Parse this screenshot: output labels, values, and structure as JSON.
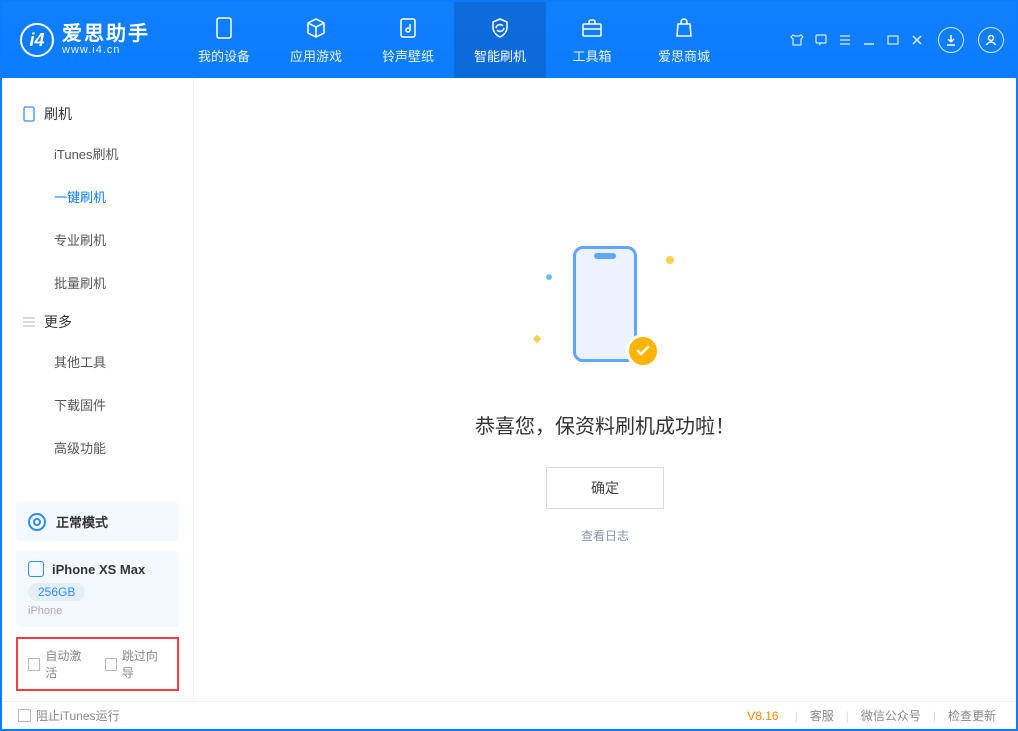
{
  "app": {
    "name_cn": "爱思助手",
    "url": "www.i4.cn"
  },
  "tabs": {
    "device": "我的设备",
    "apps": "应用游戏",
    "ringtone": "铃声壁纸",
    "flash": "智能刷机",
    "toolbox": "工具箱",
    "store": "爱思商城"
  },
  "sidebar": {
    "group1": {
      "title": "刷机",
      "items": [
        "iTunes刷机",
        "一键刷机",
        "专业刷机",
        "批量刷机"
      ],
      "active_index": 1
    },
    "group2": {
      "title": "更多",
      "items": [
        "其他工具",
        "下载固件",
        "高级功能"
      ]
    },
    "mode": "正常模式",
    "device": {
      "name": "iPhone XS Max",
      "capacity": "256GB",
      "type": "iPhone"
    },
    "opt1": "自动激活",
    "opt2": "跳过向导"
  },
  "main": {
    "message": "恭喜您，保资料刷机成功啦！",
    "ok": "确定",
    "view_log": "查看日志"
  },
  "footer": {
    "block_itunes": "阻止iTunes运行",
    "version": "V8.16",
    "service": "客服",
    "wechat": "微信公众号",
    "update": "检查更新"
  }
}
